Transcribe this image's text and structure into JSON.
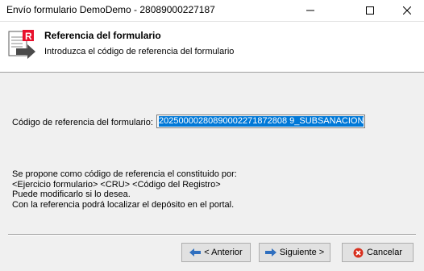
{
  "window": {
    "title": "Envío formulario DemoDemo - 28089000227187"
  },
  "header": {
    "title": "Referencia del formulario",
    "subtitle": "Introduzca el código de referencia del formulario",
    "logo_icon": "registro-logo-icon"
  },
  "form": {
    "ref_label": "Código de referencia del formulario:",
    "ref_value": "20250000280890002271872808 9_SUBSANACION"
  },
  "info": {
    "lines": [
      "Se propone como código de referencia el constituido por:",
      "<Ejercicio formulario> <CRU> <Código del Registro>",
      "Puede modificarlo si lo desea.",
      "Con la referencia podrá localizar el depósito en el portal."
    ]
  },
  "buttons": {
    "prev_label": "< Anterior",
    "next_label": "Siguiente >",
    "cancel_label": "Cancelar"
  },
  "colors": {
    "selection": "#0078d7",
    "cancel_icon": "#d8301e",
    "arrow_icon": "#2f6fbf",
    "logo_red": "#e8112d"
  }
}
